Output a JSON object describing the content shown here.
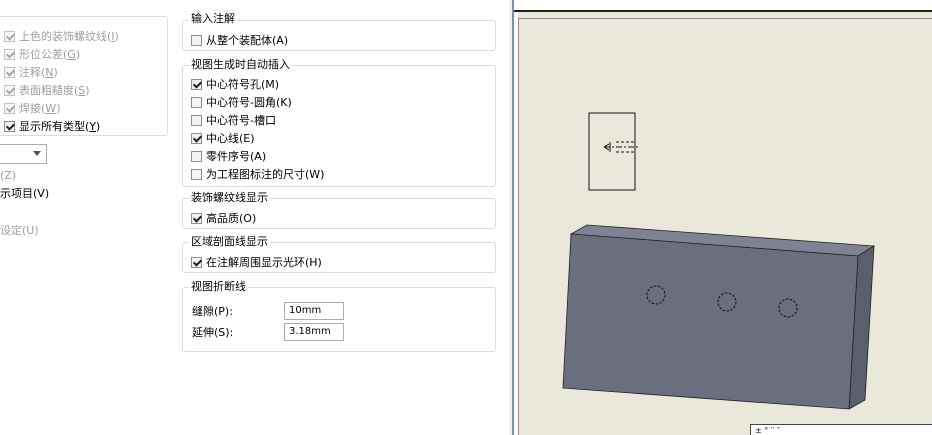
{
  "left_col": {
    "checkboxes": [
      {
        "label": "上色的装饰螺纹线(",
        "key": "I",
        "checked": true,
        "disabled": true
      },
      {
        "label": "形位公差(",
        "key": "G",
        "checked": true,
        "disabled": true
      },
      {
        "label": "注释(",
        "key": "N",
        "checked": true,
        "disabled": true
      },
      {
        "label": "表面粗糙度(",
        "key": "S",
        "checked": true,
        "disabled": true
      },
      {
        "label": "焊接(",
        "key": "W",
        "checked": true,
        "disabled": true
      },
      {
        "label": "显示所有类型(",
        "key": "Y",
        "checked": true,
        "disabled": false
      }
    ],
    "z_label": "(Z)",
    "display_items_label": "示项目(V)",
    "settings_label": "设定(U)"
  },
  "input_annotations": {
    "title": "输入注解",
    "items": [
      {
        "label": "从整个装配体(A)",
        "checked": false
      }
    ]
  },
  "auto_insert": {
    "title": "视图生成时自动插入",
    "items": [
      {
        "label": "中心符号孔(M)",
        "checked": true
      },
      {
        "label": "中心符号-圆角(K)",
        "checked": false
      },
      {
        "label": "中心符号-槽口",
        "checked": false
      },
      {
        "label": "中心线(E)",
        "checked": true
      },
      {
        "label": "零件序号(A)",
        "checked": false
      },
      {
        "label": "为工程图标注的尺寸(W)",
        "checked": false
      }
    ]
  },
  "cosmetic_thread": {
    "title": "装饰螺纹线显示",
    "items": [
      {
        "label": "高品质(O)",
        "checked": true
      }
    ]
  },
  "section_hatch": {
    "title": "区域剖面线显示",
    "items": [
      {
        "label": "在注解周围显示光环(H)",
        "checked": true
      }
    ]
  },
  "break_line": {
    "title": "视图折断线",
    "gap_label": "缝隙(P):",
    "gap_value": "10mm",
    "extend_label": "延伸(S):",
    "extend_value": "3.18mm"
  },
  "viewport": {
    "corner_text": "± ° ′′ ″"
  },
  "colors": {
    "part_face": "#6b6e7e",
    "part_top": "#7f8292",
    "part_side": "#5b5e6c",
    "viewport_bg": "#e9e8da"
  }
}
